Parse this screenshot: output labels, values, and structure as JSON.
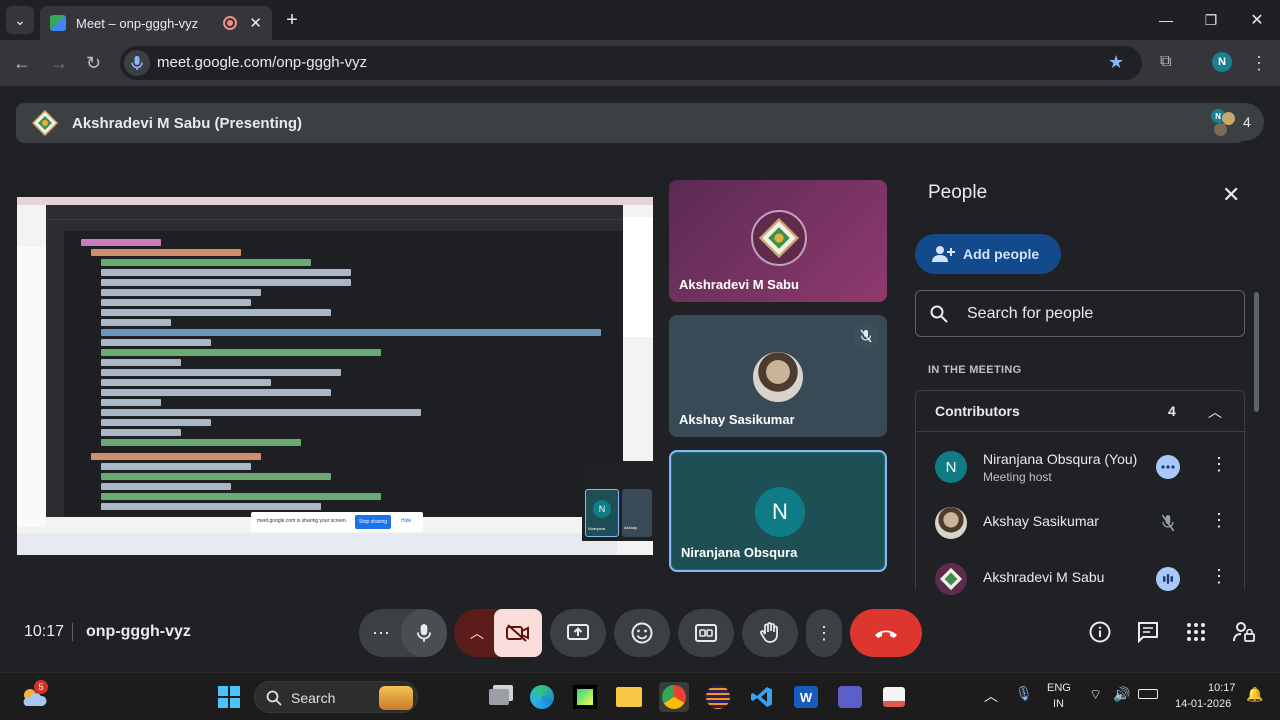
{
  "browser": {
    "tab_title": "Meet – onp-gggh-vyz",
    "new_tab_icon": "plus-icon",
    "url": "meet.google.com/onp-gggh-vyz",
    "profile_initial": "N"
  },
  "presenting": {
    "name": "Akshradevi M Sabu (Presenting)",
    "participant_count": "4",
    "participant_initial": "N"
  },
  "shared_screen": {
    "share_notice": "meet.google.com is sharing your screen.",
    "stop_sharing": "Stop sharing",
    "hide": "Hide",
    "mini_meet_label": "Niranjana",
    "mini_meet_label2": "Akshay",
    "mini_initial": "N"
  },
  "tiles": [
    {
      "name": "Akshradevi M Sabu"
    },
    {
      "name": "Akshay Sasikumar"
    },
    {
      "name": "Niranjana Obsqura",
      "initial": "N"
    }
  ],
  "people_panel": {
    "title": "People",
    "add_people": "Add people",
    "search_placeholder": "Search for people",
    "section": "IN THE MEETING",
    "group_title": "Contributors",
    "group_count": "4",
    "participants": [
      {
        "name": "Niranjana Obsqura (You)",
        "sub": "Meeting host",
        "initial": "N"
      },
      {
        "name": "Akshay Sasikumar",
        "sub": ""
      },
      {
        "name": "Akshradevi M Sabu",
        "sub": ""
      }
    ]
  },
  "bottom_bar": {
    "time": "10:17",
    "meeting_code": "onp-gggh-vyz"
  },
  "taskbar": {
    "search": "Search",
    "weather_badge": "5",
    "lang_top": "ENG",
    "lang_bottom": "IN",
    "time": "10:17",
    "date": "14-01-2026"
  },
  "colors": {
    "accent_blue": "#8ab4f8",
    "hangup_red": "#ea4335",
    "camera_off_pink": "#f9dedc"
  }
}
